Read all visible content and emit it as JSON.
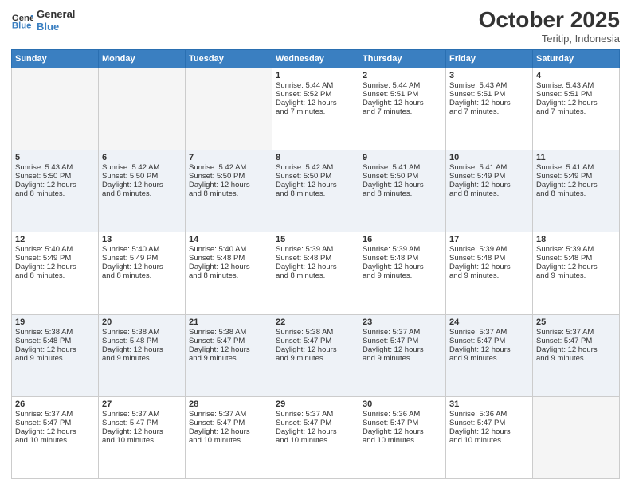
{
  "header": {
    "logo_line1": "General",
    "logo_line2": "Blue",
    "month": "October 2025",
    "location": "Teritip, Indonesia"
  },
  "days_of_week": [
    "Sunday",
    "Monday",
    "Tuesday",
    "Wednesday",
    "Thursday",
    "Friday",
    "Saturday"
  ],
  "weeks": [
    [
      {
        "day": "",
        "info": ""
      },
      {
        "day": "",
        "info": ""
      },
      {
        "day": "",
        "info": ""
      },
      {
        "day": "1",
        "info": "Sunrise: 5:44 AM\nSunset: 5:52 PM\nDaylight: 12 hours\nand 7 minutes."
      },
      {
        "day": "2",
        "info": "Sunrise: 5:44 AM\nSunset: 5:51 PM\nDaylight: 12 hours\nand 7 minutes."
      },
      {
        "day": "3",
        "info": "Sunrise: 5:43 AM\nSunset: 5:51 PM\nDaylight: 12 hours\nand 7 minutes."
      },
      {
        "day": "4",
        "info": "Sunrise: 5:43 AM\nSunset: 5:51 PM\nDaylight: 12 hours\nand 7 minutes."
      }
    ],
    [
      {
        "day": "5",
        "info": "Sunrise: 5:43 AM\nSunset: 5:50 PM\nDaylight: 12 hours\nand 8 minutes."
      },
      {
        "day": "6",
        "info": "Sunrise: 5:42 AM\nSunset: 5:50 PM\nDaylight: 12 hours\nand 8 minutes."
      },
      {
        "day": "7",
        "info": "Sunrise: 5:42 AM\nSunset: 5:50 PM\nDaylight: 12 hours\nand 8 minutes."
      },
      {
        "day": "8",
        "info": "Sunrise: 5:42 AM\nSunset: 5:50 PM\nDaylight: 12 hours\nand 8 minutes."
      },
      {
        "day": "9",
        "info": "Sunrise: 5:41 AM\nSunset: 5:50 PM\nDaylight: 12 hours\nand 8 minutes."
      },
      {
        "day": "10",
        "info": "Sunrise: 5:41 AM\nSunset: 5:49 PM\nDaylight: 12 hours\nand 8 minutes."
      },
      {
        "day": "11",
        "info": "Sunrise: 5:41 AM\nSunset: 5:49 PM\nDaylight: 12 hours\nand 8 minutes."
      }
    ],
    [
      {
        "day": "12",
        "info": "Sunrise: 5:40 AM\nSunset: 5:49 PM\nDaylight: 12 hours\nand 8 minutes."
      },
      {
        "day": "13",
        "info": "Sunrise: 5:40 AM\nSunset: 5:49 PM\nDaylight: 12 hours\nand 8 minutes."
      },
      {
        "day": "14",
        "info": "Sunrise: 5:40 AM\nSunset: 5:48 PM\nDaylight: 12 hours\nand 8 minutes."
      },
      {
        "day": "15",
        "info": "Sunrise: 5:39 AM\nSunset: 5:48 PM\nDaylight: 12 hours\nand 8 minutes."
      },
      {
        "day": "16",
        "info": "Sunrise: 5:39 AM\nSunset: 5:48 PM\nDaylight: 12 hours\nand 9 minutes."
      },
      {
        "day": "17",
        "info": "Sunrise: 5:39 AM\nSunset: 5:48 PM\nDaylight: 12 hours\nand 9 minutes."
      },
      {
        "day": "18",
        "info": "Sunrise: 5:39 AM\nSunset: 5:48 PM\nDaylight: 12 hours\nand 9 minutes."
      }
    ],
    [
      {
        "day": "19",
        "info": "Sunrise: 5:38 AM\nSunset: 5:48 PM\nDaylight: 12 hours\nand 9 minutes."
      },
      {
        "day": "20",
        "info": "Sunrise: 5:38 AM\nSunset: 5:48 PM\nDaylight: 12 hours\nand 9 minutes."
      },
      {
        "day": "21",
        "info": "Sunrise: 5:38 AM\nSunset: 5:47 PM\nDaylight: 12 hours\nand 9 minutes."
      },
      {
        "day": "22",
        "info": "Sunrise: 5:38 AM\nSunset: 5:47 PM\nDaylight: 12 hours\nand 9 minutes."
      },
      {
        "day": "23",
        "info": "Sunrise: 5:37 AM\nSunset: 5:47 PM\nDaylight: 12 hours\nand 9 minutes."
      },
      {
        "day": "24",
        "info": "Sunrise: 5:37 AM\nSunset: 5:47 PM\nDaylight: 12 hours\nand 9 minutes."
      },
      {
        "day": "25",
        "info": "Sunrise: 5:37 AM\nSunset: 5:47 PM\nDaylight: 12 hours\nand 9 minutes."
      }
    ],
    [
      {
        "day": "26",
        "info": "Sunrise: 5:37 AM\nSunset: 5:47 PM\nDaylight: 12 hours\nand 10 minutes."
      },
      {
        "day": "27",
        "info": "Sunrise: 5:37 AM\nSunset: 5:47 PM\nDaylight: 12 hours\nand 10 minutes."
      },
      {
        "day": "28",
        "info": "Sunrise: 5:37 AM\nSunset: 5:47 PM\nDaylight: 12 hours\nand 10 minutes."
      },
      {
        "day": "29",
        "info": "Sunrise: 5:37 AM\nSunset: 5:47 PM\nDaylight: 12 hours\nand 10 minutes."
      },
      {
        "day": "30",
        "info": "Sunrise: 5:36 AM\nSunset: 5:47 PM\nDaylight: 12 hours\nand 10 minutes."
      },
      {
        "day": "31",
        "info": "Sunrise: 5:36 AM\nSunset: 5:47 PM\nDaylight: 12 hours\nand 10 minutes."
      },
      {
        "day": "",
        "info": ""
      }
    ]
  ]
}
